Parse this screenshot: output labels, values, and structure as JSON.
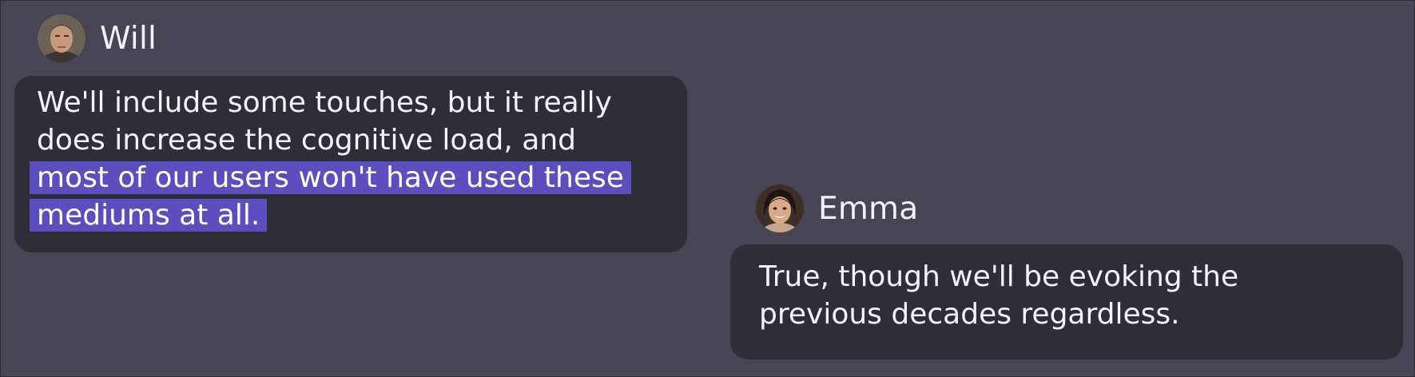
{
  "conversation": {
    "messages": [
      {
        "sender": "Will",
        "avatar_icon": "will-avatar-photo",
        "lines": [
          "We'll include some touches, but it really",
          "does increase the cognitive load, and"
        ],
        "highlighted_lines": [
          "most of our users won't have used these",
          "mediums at all."
        ],
        "highlight_color": "#5b4fbf"
      },
      {
        "sender": "Emma",
        "avatar_icon": "emma-avatar-photo",
        "lines": [
          "True, though we'll be evoking the",
          "previous decades regardless."
        ]
      }
    ]
  },
  "colors": {
    "background": "#474553",
    "bubble": "#2f2e37",
    "text": "#f2f1f6"
  }
}
